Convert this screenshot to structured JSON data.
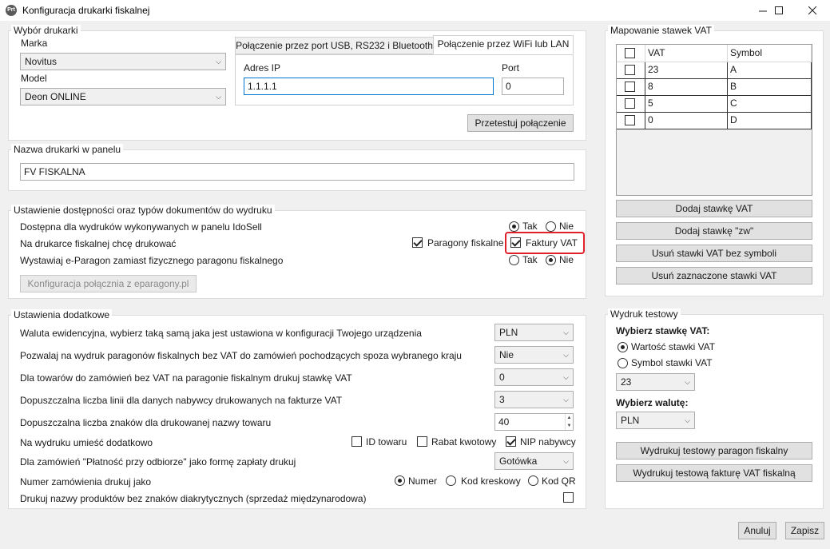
{
  "window": {
    "title": "Konfiguracja drukarki fiskalnej",
    "icon_text": "Prt",
    "minimize_icon": "minimize-icon",
    "maximize_icon": "maximize-icon",
    "close_icon": "close-icon"
  },
  "printer_selection": {
    "group_title": "Wybór drukarki",
    "brand_label": "Marka",
    "brand_value": "Novitus",
    "model_label": "Model",
    "model_value": "Deon ONLINE",
    "tabs": [
      {
        "label": "Połączenie przez port USB, RS232 i Bluetooth",
        "active": false
      },
      {
        "label": "Połączenie przez WiFi lub LAN",
        "active": true
      }
    ],
    "ip_label": "Adres IP",
    "ip_value": "1.1.1.1",
    "port_label": "Port",
    "port_value": "0",
    "test_button": "Przetestuj połączenie"
  },
  "printer_name": {
    "group_title": "Nazwa drukarki w panelu",
    "value": "FV FISKALNA"
  },
  "availability": {
    "group_title": "Ustawienie dostępności oraz typów dokumentów do wydruku",
    "row1_label": "Dostępna dla wydruków wykonywanych w panelu IdoSell",
    "row1_yes": "Tak",
    "row1_no": "Nie",
    "row1_selected": "yes",
    "row2_label": "Na drukarce fiskalnej chcę drukować",
    "row2_receipts": "Paragony fiskalne",
    "row2_receipts_checked": true,
    "row2_invoices": "Faktury VAT",
    "row2_invoices_checked": true,
    "row3_label": "Wystawiaj e-Paragon zamiast fizycznego paragonu fiskalnego",
    "row3_yes": "Tak",
    "row3_no": "Nie",
    "row3_selected": "no",
    "eparagon_button": "Konfiguracja połącznia z eparagony.pl"
  },
  "additional": {
    "group_title": "Ustawienia dodatkowe",
    "currency_label": "Waluta ewidencyjna, wybierz taką samą jaka jest ustawiona w konfiguracji Twojego urządzenia",
    "currency_value": "PLN",
    "no_vat_label": "Pozwalaj na wydruk paragonów fiskalnych bez VAT do zamówień pochodzących spoza wybranego kraju",
    "no_vat_value": "Nie",
    "vat_rate_label": "Dla towarów do zamówień bez VAT na paragonie fiskalnym drukuj stawkę VAT",
    "vat_rate_value": "0",
    "lines_label": "Dopuszczalna liczba linii dla danych nabywcy drukowanych na fakturze VAT",
    "lines_value": "3",
    "chars_label": "Dopuszczalna liczba znaków dla drukowanej nazwy towaru",
    "chars_value": "40",
    "extra_label": "Na wydruku umieść dodatkowo",
    "extra_product_id": "ID towaru",
    "extra_product_id_checked": false,
    "extra_discount": "Rabat kwotowy",
    "extra_discount_checked": false,
    "extra_nip": "NIP nabywcy",
    "extra_nip_checked": true,
    "cod_label": "Dla zamówień \"Płatność przy odbiorze\" jako formę zapłaty drukuj",
    "cod_value": "Gotówka",
    "order_number_label": "Numer zamówienia drukuj jako",
    "order_number_number": "Numer",
    "order_number_barcode": "Kod kreskowy",
    "order_number_qr": "Kod QR",
    "order_number_selected": "number",
    "diacritics_label": "Drukuj nazwy produktów bez znaków diakrytycznych (sprzedaż międzynarodowa)",
    "diacritics_checked": false
  },
  "vat_mapping": {
    "group_title": "Mapowanie stawek VAT",
    "columns": [
      "VAT",
      "Symbol"
    ],
    "rows": [
      {
        "vat": "23",
        "symbol": "A"
      },
      {
        "vat": "8",
        "symbol": "B"
      },
      {
        "vat": "5",
        "symbol": "C"
      },
      {
        "vat": "0",
        "symbol": "D"
      }
    ],
    "add_button": "Dodaj stawkę VAT",
    "add_zw_button": "Dodaj stawkę \"zw\"",
    "remove_no_symbol_button": "Usuń stawki VAT bez symboli",
    "remove_selected_button": "Usuń zaznaczone stawki VAT"
  },
  "test_print": {
    "group_title": "Wydruk testowy",
    "choose_vat_label": "Wybierz stawkę VAT:",
    "opt_value": "Wartość stawki VAT",
    "opt_symbol": "Symbol stawki VAT",
    "selected": "value",
    "vat_combo": "23",
    "choose_currency_label": "Wybierz walutę:",
    "currency_combo": "PLN",
    "print_receipt_button": "Wydrukuj testowy paragon fiskalny",
    "print_invoice_button": "Wydrukuj testową fakturę VAT fiskalną"
  },
  "footer": {
    "cancel_button": "Anuluj",
    "save_button": "Zapisz"
  }
}
